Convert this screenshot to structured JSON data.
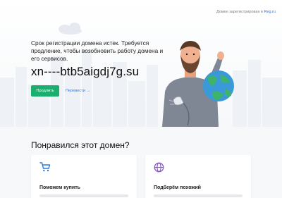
{
  "header": {
    "note_text": "Домен зарегистрирован в",
    "note_link": "Reg.ru"
  },
  "main": {
    "message": "Срок регистрации домена истек. Требуется продление, чтобы возобновить работу домена и его сервисов.",
    "domain": "xn----btb5aigdj7g.su",
    "extend_label": "Продлить",
    "transfer_label": "Перевести →"
  },
  "section": {
    "title": "Понравился этот домен?",
    "cards": [
      {
        "title": "Поможем купить",
        "icon": "cart-icon"
      },
      {
        "title": "Подберём похожий",
        "icon": "globe-icon"
      }
    ]
  },
  "colors": {
    "accent": "#1aae6f",
    "link": "#2a7ae2",
    "icon": "#2a7ae2"
  }
}
